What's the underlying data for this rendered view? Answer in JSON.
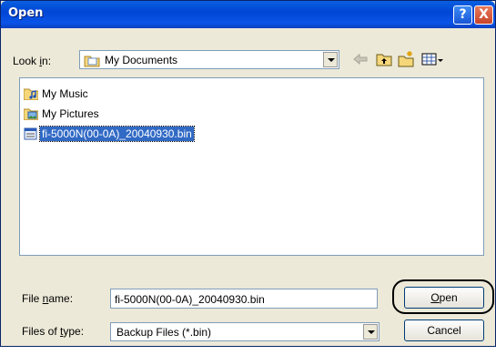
{
  "window": {
    "title": "Open"
  },
  "titlebar_buttons": {
    "help": "?",
    "close": "X"
  },
  "lookin": {
    "label_prefix": "Look ",
    "label_accel": "i",
    "label_suffix": "n:",
    "value": "My Documents"
  },
  "toolbar": {
    "icons": [
      "back-arrow-icon",
      "up-folder-icon",
      "new-folder-icon",
      "views-menu-icon"
    ]
  },
  "files": [
    {
      "name": "My Music",
      "icon": "music-folder-icon",
      "selected": false
    },
    {
      "name": "My Pictures",
      "icon": "pictures-folder-icon",
      "selected": false
    },
    {
      "name": "fi-5000N(00-0A)_20040930.bin",
      "icon": "bin-file-icon",
      "selected": true
    }
  ],
  "filename": {
    "label_prefix": "File ",
    "label_accel": "n",
    "label_suffix": "ame:",
    "value": "fi-5000N(00-0A)_20040930.bin"
  },
  "filetype": {
    "label_prefix": "Files of ",
    "label_accel": "t",
    "label_suffix": "ype:",
    "value": "Backup Files (*.bin)"
  },
  "buttons": {
    "open_accel": "O",
    "open_rest": "pen",
    "cancel": "Cancel"
  },
  "colors": {
    "title_bar": "#0046d5",
    "dialog_bg": "#ece9d8",
    "selection": "#316ac5",
    "close": "#c7442a"
  }
}
